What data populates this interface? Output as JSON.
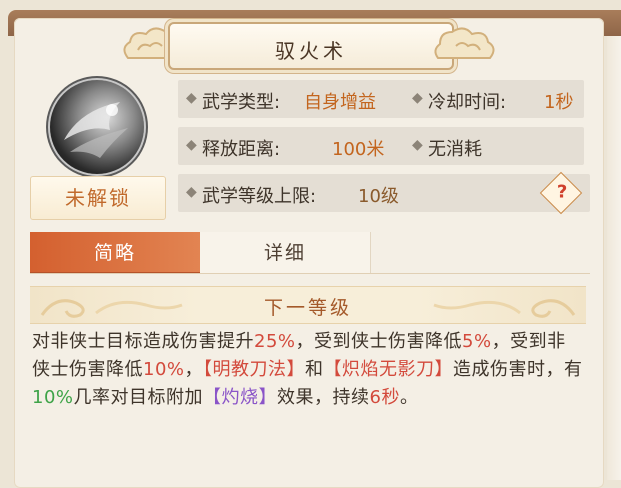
{
  "skill": {
    "title": "驭火术",
    "lock_label": "未解锁",
    "icon": "silver-swirl-orb-icon"
  },
  "info": {
    "type_label": "武学类型:",
    "type_value": "自身增益",
    "cooldown_label": "冷却时间:",
    "cooldown_value": "1秒",
    "range_label": "释放距离:",
    "range_value": "100米",
    "cost_label": "无消耗",
    "level_cap_label": "武学等级上限:",
    "level_cap_value": "10级",
    "help_glyph": "?"
  },
  "tabs": [
    {
      "label": "简略",
      "active": true
    },
    {
      "label": "详细",
      "active": false
    }
  ],
  "section": {
    "title": "下一等级"
  },
  "description": {
    "p1": "对非侠士目标造成伤害提升",
    "v1": "25%",
    "p2": "，受到侠士伤害降低",
    "v2": "5%",
    "p3": "，受到非侠士伤害降低",
    "v3": "10%",
    "p4": "，",
    "skill1": "【明教刀法】",
    "p5": "和",
    "skill2": "【炽焰无影刀】",
    "p6": "造成伤害时，有",
    "v4": "10%",
    "p7": "几率对目标附加",
    "effect": "【灼烧】",
    "p8": "效果，持续",
    "v5": "6秒",
    "p9": "。"
  },
  "colors": {
    "accent_orange": "#d4602f",
    "value_orange": "#c3651e",
    "highlight_red": "#d34a3c",
    "highlight_green": "#3ea348",
    "highlight_purple": "#8a54c8"
  }
}
